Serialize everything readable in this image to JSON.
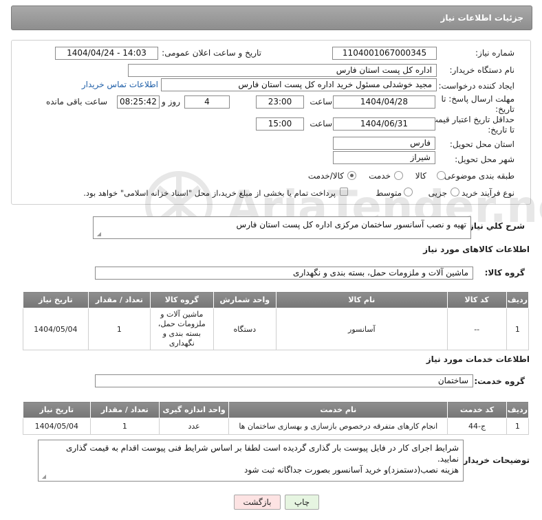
{
  "header": {
    "title": "جزئیات اطلاعات نیاز"
  },
  "form": {
    "need_number": {
      "label": "شماره نیاز:",
      "value": "1104001067000345"
    },
    "announce_datetime": {
      "label": "تاریخ و ساعت اعلان عمومی:",
      "value": "1404/04/24 - 14:03"
    },
    "buyer_org": {
      "label": "نام دستگاه خریدار:",
      "value": "اداره کل پست استان فارس"
    },
    "requester": {
      "label": "ایجاد کننده درخواست:",
      "value": "مجید خوشدلی مسئول خرید اداره کل پست استان فارس",
      "contact_link": "اطلاعات تماس خریدار"
    },
    "reply_deadline": {
      "label_line1": "مهلت ارسال پاسخ: تا",
      "label_line2": "تاریخ:",
      "date": "1404/04/28",
      "time_label": "ساعت",
      "time": "23:00",
      "days": "4",
      "days_label": "روز و",
      "remaining": "08:25:42",
      "remaining_label": "ساعت باقی مانده"
    },
    "price_validity": {
      "label_line1": "حداقل تاریخ اعتبار قیمت:",
      "label_line2": "تا تاریخ:",
      "date": "1404/06/31",
      "time_label": "ساعت",
      "time": "15:00"
    },
    "delivery_province": {
      "label": "استان محل تحویل:",
      "value": "فارس"
    },
    "delivery_city": {
      "label": "شهر محل تحویل:",
      "value": "شیراز"
    },
    "category": {
      "label": "طبقه بندی موضوعی:",
      "options": [
        "کالا",
        "خدمت",
        "کالا/خدمت"
      ],
      "selected": "کالا/خدمت"
    },
    "purchase_type": {
      "label": "نوع فرآیند خرید :",
      "options": [
        "جزیی",
        "متوسط"
      ],
      "selected": "",
      "payment_note": "پرداخت تمام یا بخشی از مبلغ خرید،از محل \"اسناد خزانه اسلامی\" خواهد بود."
    }
  },
  "summary": {
    "label": "شرح کلي نياز:",
    "value": "تهیه و نصب آسانسور ساختمان مرکزی اداره کل پست استان فارس"
  },
  "goods": {
    "section_title": "اطلاعات کالاهای مورد نیاز",
    "group_label": "گروه کالا:",
    "group_value": "ماشین آلات و ملزومات حمل، بسته بندی و نگهداری",
    "columns": [
      "ردیف",
      "کد کالا",
      "نام کالا",
      "واحد شمارش",
      "گروه کالا",
      "تعداد / مقدار",
      "تاریخ نیاز"
    ],
    "rows": [
      [
        "1",
        "--",
        "آسانسور",
        "دستگاه",
        "ماشین آلات و ملزومات حمل، بسته بندی و نگهداری",
        "1",
        "1404/05/04"
      ]
    ]
  },
  "services": {
    "section_title": "اطلاعات خدمات مورد نیاز",
    "group_label": "گروه خدمت:",
    "group_value": "ساختمان",
    "columns": [
      "ردیف",
      "کد خدمت",
      "نام خدمت",
      "واحد اندازه گیری",
      "تعداد / مقدار",
      "تاریخ نیاز"
    ],
    "rows": [
      [
        "1",
        "ج-44",
        "انجام کارهای متفرقه درخصوص بازسازی و بهسازی ساختمان ها",
        "عدد",
        "1",
        "1404/05/04"
      ]
    ]
  },
  "buyer_notes": {
    "label": "توضیحات خریدار:",
    "line1": "شرایط اجرای کار در فایل پیوست بار گذاری گردیده است لطفا بر اساس شرایط فنی پیوست اقدام به قیمت گذاری نمایید.",
    "line2": "هزینه نصب(دستمزد)و خرید آسانسور بصورت جداگانه ثبت شود"
  },
  "buttons": {
    "print": "چاپ",
    "back": "بازگشت"
  },
  "watermark": "AriaTender.neT",
  "colors": {
    "header_bg": "#999999",
    "table_header_bg": "#808080",
    "back_button_bg": "#fde3e3",
    "print_button_bg": "#e6f5e1",
    "link": "#1f5fa8"
  }
}
